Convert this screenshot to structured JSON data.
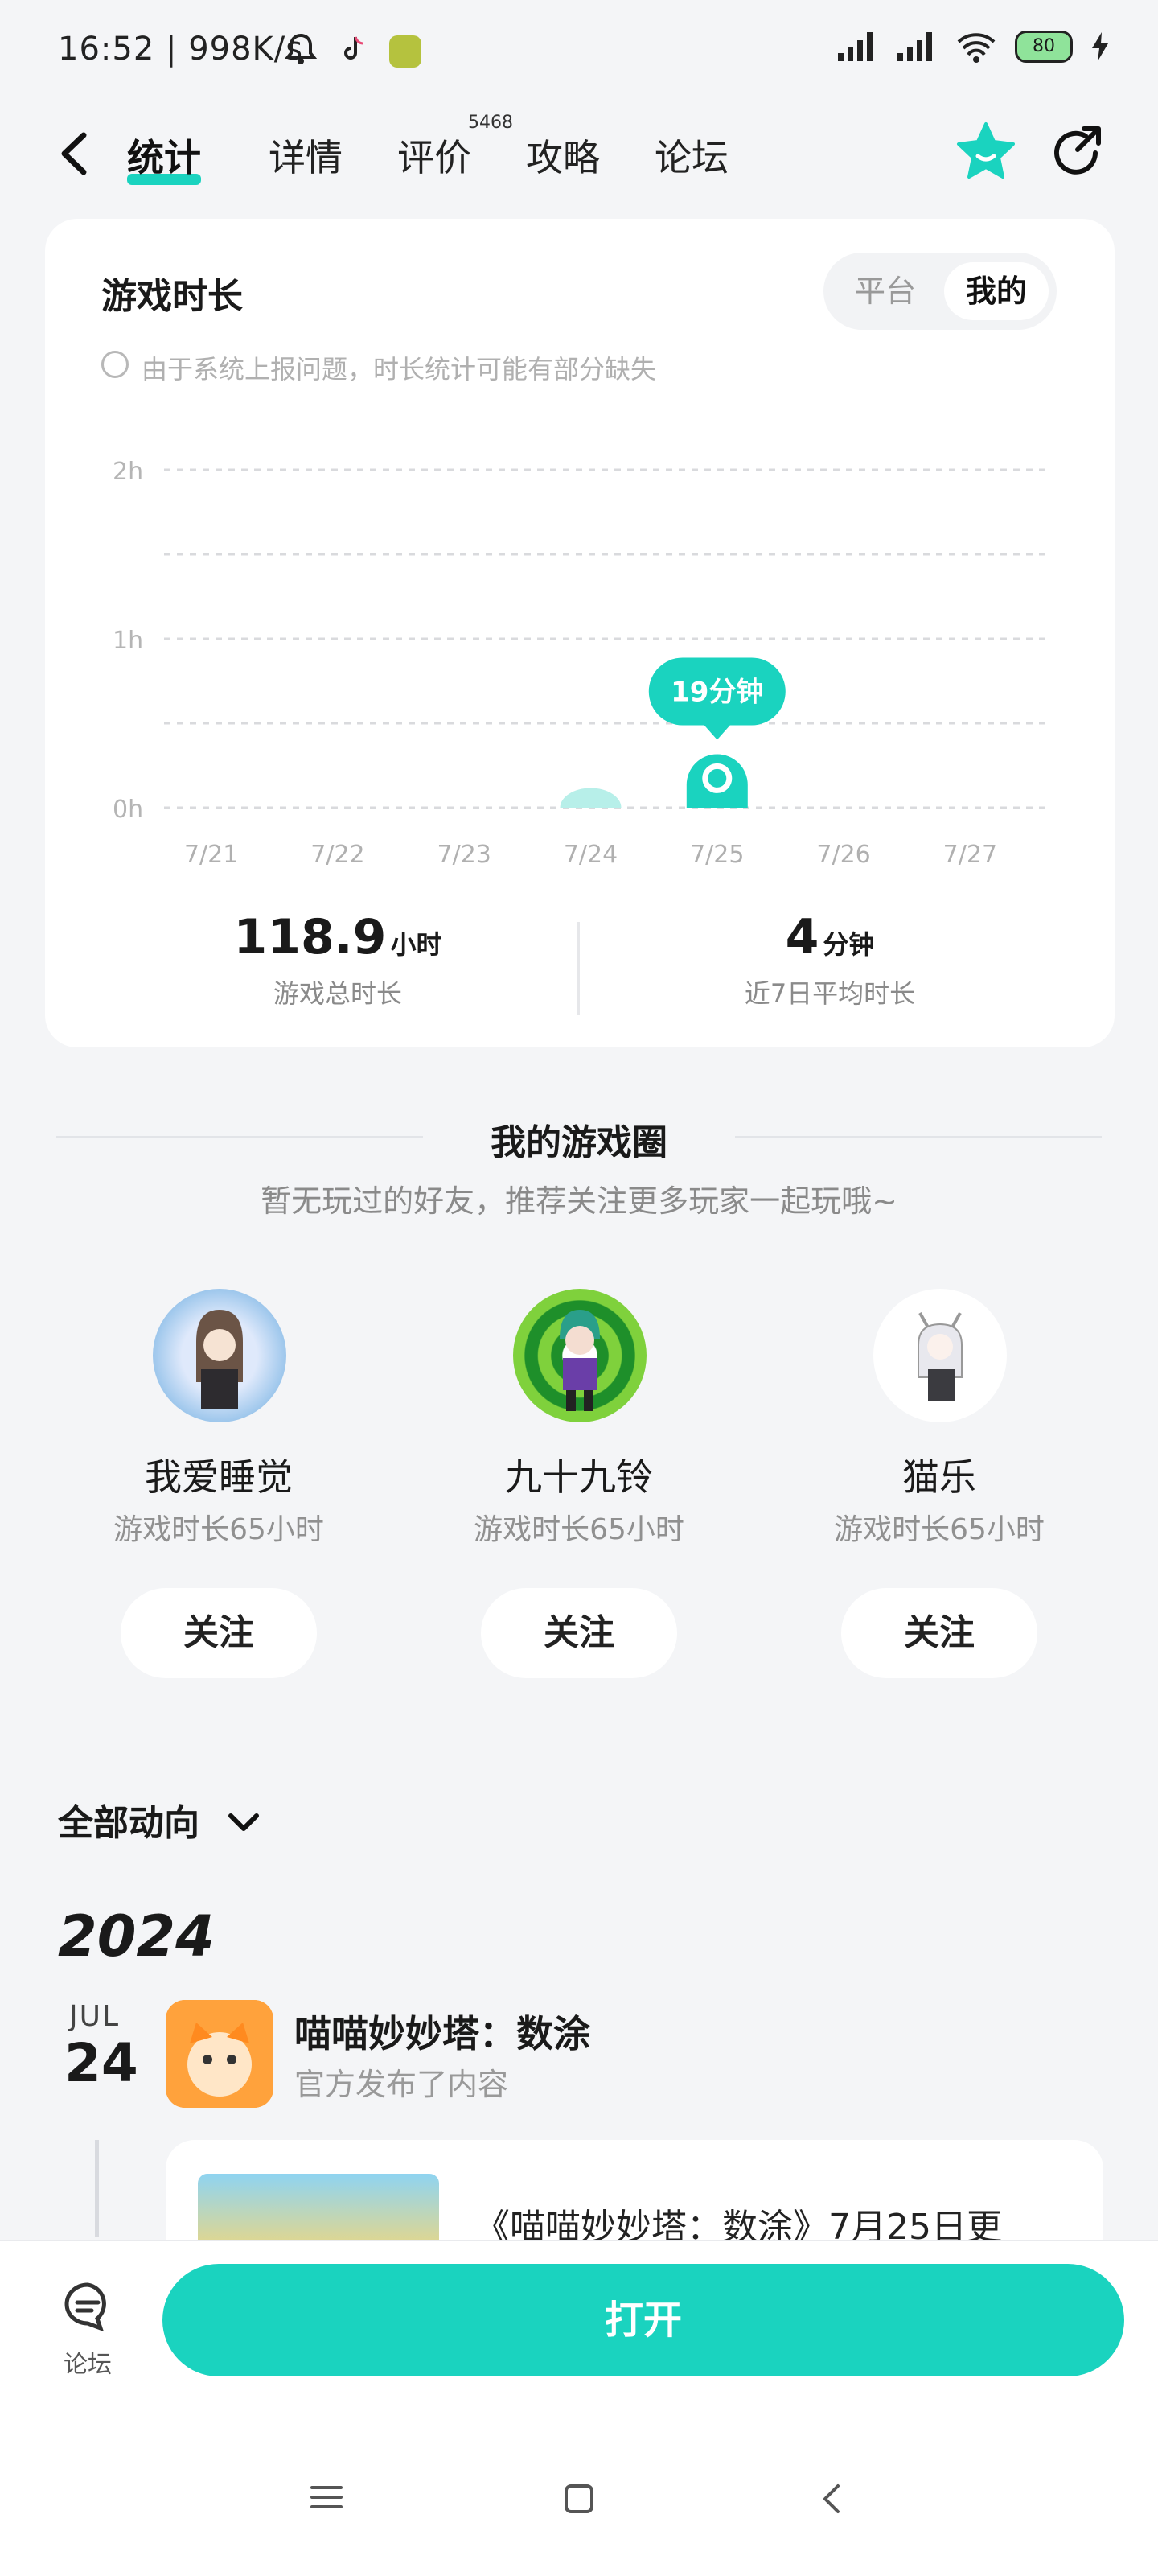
{
  "status_bar": {
    "time": "16:52",
    "speed": "998K/s",
    "battery": "80"
  },
  "nav": {
    "tabs": [
      {
        "label": "统计",
        "active": true
      },
      {
        "label": "详情"
      },
      {
        "label": "评价",
        "badge": "5468"
      },
      {
        "label": "攻略"
      },
      {
        "label": "论坛"
      }
    ]
  },
  "playtime": {
    "title": "游戏时长",
    "toggle": [
      "平台",
      "我的"
    ],
    "toggle_selected": "我的",
    "note": "由于系统上报问题，时长统计可能有部分缺失",
    "total_value": "118.9",
    "total_unit": "小时",
    "total_label": "游戏总时长",
    "avg_value": "4",
    "avg_unit": "分钟",
    "avg_label": "近7日平均时长"
  },
  "chart_data": {
    "type": "bar",
    "categories": [
      "7/21",
      "7/22",
      "7/23",
      "7/24",
      "7/25",
      "7/26",
      "7/27"
    ],
    "values": [
      0,
      0,
      0,
      7,
      19
    ],
    "unit": "minutes",
    "y_ticks": [
      "0h",
      "1h",
      "2h"
    ],
    "ylim": [
      0,
      120
    ],
    "highlight_index": 4,
    "tooltip": "19分钟",
    "grid": true,
    "colors": {
      "bar": "#b7efe9",
      "active": "#1ad3bf"
    }
  },
  "circle": {
    "title": "我的游戏圈",
    "subtitle": "暂无玩过的好友，推荐关注更多玩家一起玩哦~",
    "friends": [
      {
        "name": "我爱睡觉",
        "meta": "游戏时长65小时",
        "follow": "关注"
      },
      {
        "name": "九十九铃",
        "meta": "游戏时长65小时",
        "follow": "关注"
      },
      {
        "name": "猫乐",
        "meta": "游戏时长65小时",
        "follow": "关注"
      }
    ]
  },
  "feed": {
    "filter": "全部动向",
    "year": "2024",
    "month": "JUL",
    "day": "24",
    "game_title": "喵喵妙妙塔：数涂",
    "game_sub": "官方发布了内容",
    "post_text": "《喵喵妙妙塔：数涂》7月25日更"
  },
  "bottom": {
    "forum_label": "论坛",
    "open_label": "打开"
  },
  "colors": {
    "accent": "#1ad3bf",
    "background": "#f4f5f7"
  }
}
